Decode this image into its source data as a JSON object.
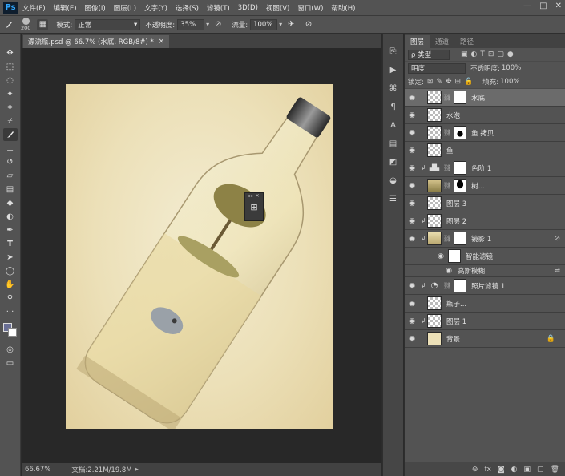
{
  "menubar": {
    "logo": "Ps",
    "items": [
      "文件(F)",
      "编辑(E)",
      "图像(I)",
      "图层(L)",
      "文字(Y)",
      "选择(S)",
      "滤镜(T)",
      "3D(D)",
      "视图(V)",
      "窗口(W)",
      "帮助(H)"
    ],
    "controls": [
      "—",
      "□",
      "✕"
    ]
  },
  "options": {
    "brush_size": "200",
    "mode_label": "模式:",
    "mode_value": "正常",
    "opacity_label": "不透明度:",
    "opacity_value": "35%",
    "flow_label": "流量:",
    "flow_value": "100%"
  },
  "document": {
    "tab_title": "漂流瓶.psd @ 66.7% (水底, RGB/8#) *",
    "tab_close": "×",
    "zoom": "66.67%",
    "doc_info": "文档:2.21M/19.8M"
  },
  "floating_panel": {
    "controls": "▸▸ ✕",
    "icon": "⊞"
  },
  "layers_panel": {
    "tabs": [
      "图层",
      "通道",
      "路径"
    ],
    "filter_label": "ρ 类型",
    "blend_mode": "明度",
    "opacity_label": "不透明度:",
    "opacity_value": "100%",
    "lock_label": "锁定:",
    "fill_label": "填充:",
    "fill_value": "100%",
    "layers": [
      {
        "name": "水底",
        "selected": true,
        "mask": true
      },
      {
        "name": "水泡"
      },
      {
        "name": "鱼 拷贝",
        "mask": true
      },
      {
        "name": "鱼"
      },
      {
        "name": "色阶 1",
        "clip": true,
        "adjust": true,
        "mask": true
      },
      {
        "name": "树...",
        "mask": true
      },
      {
        "name": "图层 3"
      },
      {
        "name": "图层 2",
        "clip": true
      },
      {
        "name": "镜影 1",
        "clip": true,
        "mask": true
      },
      {
        "name": "智能滤镜",
        "sub": true
      },
      {
        "name": "高斯模糊",
        "sub": true,
        "subsub": true
      },
      {
        "name": "照片滤镜 1",
        "clip": true,
        "adjust": true,
        "mask": true
      },
      {
        "name": "瓶子..."
      },
      {
        "name": "图层 1",
        "clip": true
      },
      {
        "name": "背景",
        "locked": true,
        "bg": true
      }
    ],
    "bottom_icons": [
      "⊖",
      "fx",
      "◙",
      "◐",
      "▣",
      "▢",
      "🗑"
    ]
  }
}
